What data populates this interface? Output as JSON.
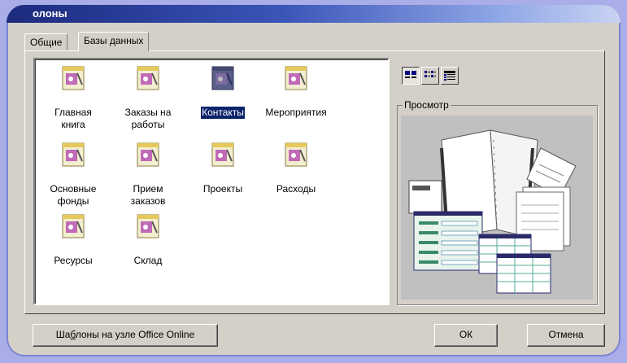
{
  "window": {
    "title": "олоны"
  },
  "tabs": [
    {
      "label": "Общие",
      "active": false
    },
    {
      "label": "Базы данных",
      "active": true
    }
  ],
  "templates": [
    {
      "label_line1": "Главная",
      "label_line2": "книга",
      "icon": "access-database-icon",
      "selected": false
    },
    {
      "label_line1": "Заказы на",
      "label_line2": "работы",
      "icon": "access-database-icon",
      "selected": false
    },
    {
      "label_line1": "Контакты",
      "label_line2": "",
      "icon": "access-database-icon",
      "selected": true
    },
    {
      "label_line1": "Мероприятия",
      "label_line2": "",
      "icon": "access-database-icon",
      "selected": false
    },
    {
      "label_line1": "Основные",
      "label_line2": "фонды",
      "icon": "access-database-icon",
      "selected": false
    },
    {
      "label_line1": "Прием",
      "label_line2": "заказов",
      "icon": "access-database-icon",
      "selected": false
    },
    {
      "label_line1": "Проекты",
      "label_line2": "",
      "icon": "access-database-icon",
      "selected": false
    },
    {
      "label_line1": "Расходы",
      "label_line2": "",
      "icon": "access-database-icon",
      "selected": false
    },
    {
      "label_line1": "Ресурсы",
      "label_line2": "",
      "icon": "access-database-icon",
      "selected": false
    },
    {
      "label_line1": "Склад",
      "label_line2": "",
      "icon": "access-database-icon",
      "selected": false
    }
  ],
  "view_buttons": [
    {
      "name": "large-icons-view-icon",
      "pressed": true
    },
    {
      "name": "list-view-icon",
      "pressed": false
    },
    {
      "name": "details-view-icon",
      "pressed": false
    }
  ],
  "preview": {
    "label": "Просмотр"
  },
  "buttons": {
    "online_prefix": "Ша",
    "online_underlined": "б",
    "online_suffix": "лоны на узле Office Online",
    "ok": "ОК",
    "cancel": "Отмена"
  },
  "colors": {
    "selection": "#0a246a",
    "dialog": "#d4d0c8",
    "backdrop": "#a9aee8"
  }
}
